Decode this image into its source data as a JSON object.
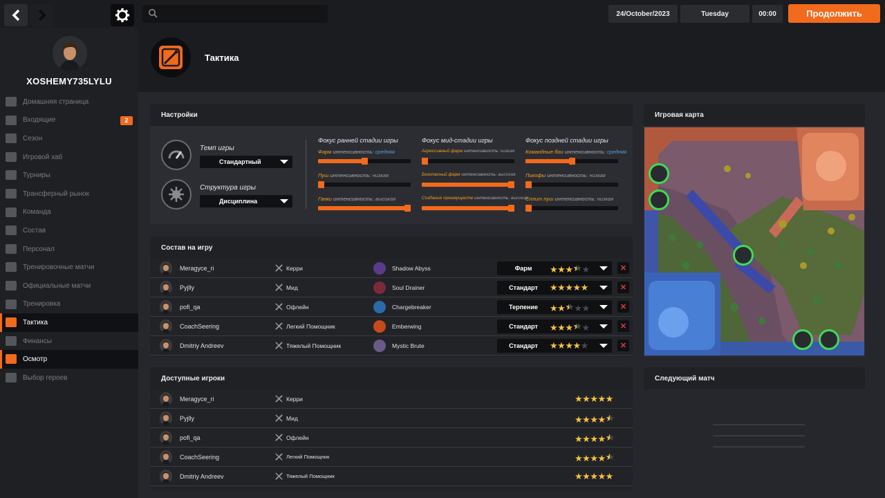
{
  "topbar": {
    "date": "24/October/2023",
    "weekday": "Tuesday",
    "time": "00:00",
    "continue_label": "Продолжить",
    "search_placeholder": ""
  },
  "profile": {
    "username": "XOSHEMY735LYLU"
  },
  "sidebar": {
    "items": [
      {
        "label": "Домашняя страница",
        "icon": "home-icon"
      },
      {
        "label": "Входящие",
        "icon": "inbox-icon",
        "badge": "2"
      },
      {
        "label": "Сезон",
        "icon": "season-icon"
      },
      {
        "label": "Игровой хаб",
        "icon": "hub-icon"
      },
      {
        "label": "Турниры",
        "icon": "trophy-icon"
      },
      {
        "label": "Трансферный рынок",
        "icon": "transfer-icon"
      },
      {
        "label": "Команда",
        "icon": "shield-icon"
      },
      {
        "label": "Состав",
        "icon": "roster-icon"
      },
      {
        "label": "Персонал",
        "icon": "staff-icon"
      },
      {
        "label": "Тренировочные матчи",
        "icon": "scrim-icon"
      },
      {
        "label": "Официальные матчи",
        "icon": "swords-icon"
      },
      {
        "label": "Тренировка",
        "icon": "training-icon"
      },
      {
        "label": "Тактика",
        "icon": "tactics-icon",
        "active": true
      },
      {
        "label": "Финансы",
        "icon": "finance-icon"
      },
      {
        "label": "Осмотр",
        "icon": "overview-icon",
        "active": true
      },
      {
        "label": "Выбор героев",
        "icon": "hero-select-icon"
      }
    ]
  },
  "page": {
    "title": "Тактика"
  },
  "settings": {
    "title": "Настройки",
    "tempo_label": "Темп игры",
    "tempo_value": "Стандартный",
    "structure_label": "Структура игры",
    "structure_value": "Дисциплина",
    "early": {
      "title": "Фокус ранней стадии игры",
      "sliders": [
        {
          "key": "Фарм",
          "mid": "интенсивность:",
          "level": "средняя",
          "value": 0.5,
          "highlight": true
        },
        {
          "key": "Пуш",
          "mid": "интенсивность:",
          "level": "низкая",
          "value": 0.0
        },
        {
          "key": "Ганки",
          "mid": "интенсивность:",
          "level": "высокая",
          "value": 1.0
        }
      ]
    },
    "mid": {
      "title": "Фокус мид-стадии игры",
      "sliders": [
        {
          "key": "Агрессивный фарм",
          "mid": "интенсивность:",
          "level": "низкая",
          "value": 0.0
        },
        {
          "key": "Безопасный фарм",
          "mid": "интенсивность:",
          "level": "высокая",
          "value": 1.0
        },
        {
          "key": "Создание преимуществ",
          "mid": "интенсивность:",
          "level": "высокая",
          "value": 1.0
        }
      ]
    },
    "late": {
      "title": "Фокус поздней стадии игры",
      "sliders": [
        {
          "key": "Командные бои",
          "mid": "интенсивность:",
          "level": "средняя",
          "value": 0.5,
          "highlight": true
        },
        {
          "key": "Пикофы",
          "mid": "интенсивность:",
          "level": "низкая",
          "value": 0.0
        },
        {
          "key": "Сплит пуш",
          "mid": "интенсивность:",
          "level": "низкая",
          "value": 0.0
        }
      ]
    }
  },
  "lineup": {
    "title": "Состав на игру",
    "rows": [
      {
        "player": "Meragyce_ri",
        "role": "Керри",
        "hero": "Shadow Abyss",
        "strategy": "Фарм",
        "stars": 3.5
      },
      {
        "player": "Pyjlly",
        "role": "Мид",
        "hero": "Soul Drainer",
        "strategy": "Стандарт",
        "stars": 5
      },
      {
        "player": "pofi_qa",
        "role": "Офлейн",
        "hero": "Chargebreaker",
        "strategy": "Терпение",
        "stars": 2.5
      },
      {
        "player": "CoachSeering",
        "role": "Легкий Помощник",
        "hero": "Emberwing",
        "strategy": "Стандарт",
        "stars": 3.5
      },
      {
        "player": "Dmitriy Andreev",
        "role": "Тяжелый Помощник",
        "hero": "Mystic Brute",
        "strategy": "Стандарт",
        "stars": 4
      }
    ]
  },
  "available": {
    "title": "Доступные игроки",
    "rows": [
      {
        "player": "Meragyce_ri",
        "role": "Керри",
        "stars": 5
      },
      {
        "player": "Pyjlly",
        "role": "Мид",
        "stars": 4.5
      },
      {
        "player": "pofi_qa",
        "role": "Офлейн",
        "stars": 4.5
      },
      {
        "player": "CoachSeering",
        "role": "Легкий Помощник",
        "stars": 4.5
      },
      {
        "player": "Dmitriy Andreev",
        "role": "Тяжелый Помощник",
        "stars": 5
      }
    ]
  },
  "map": {
    "title": "Игровая карта"
  },
  "next_match": {
    "title": "Следующий матч"
  },
  "colors": {
    "accent": "#f26a1b",
    "star": "#f5c242",
    "pin": "#3ddc57",
    "delete": "#e03a3a"
  }
}
